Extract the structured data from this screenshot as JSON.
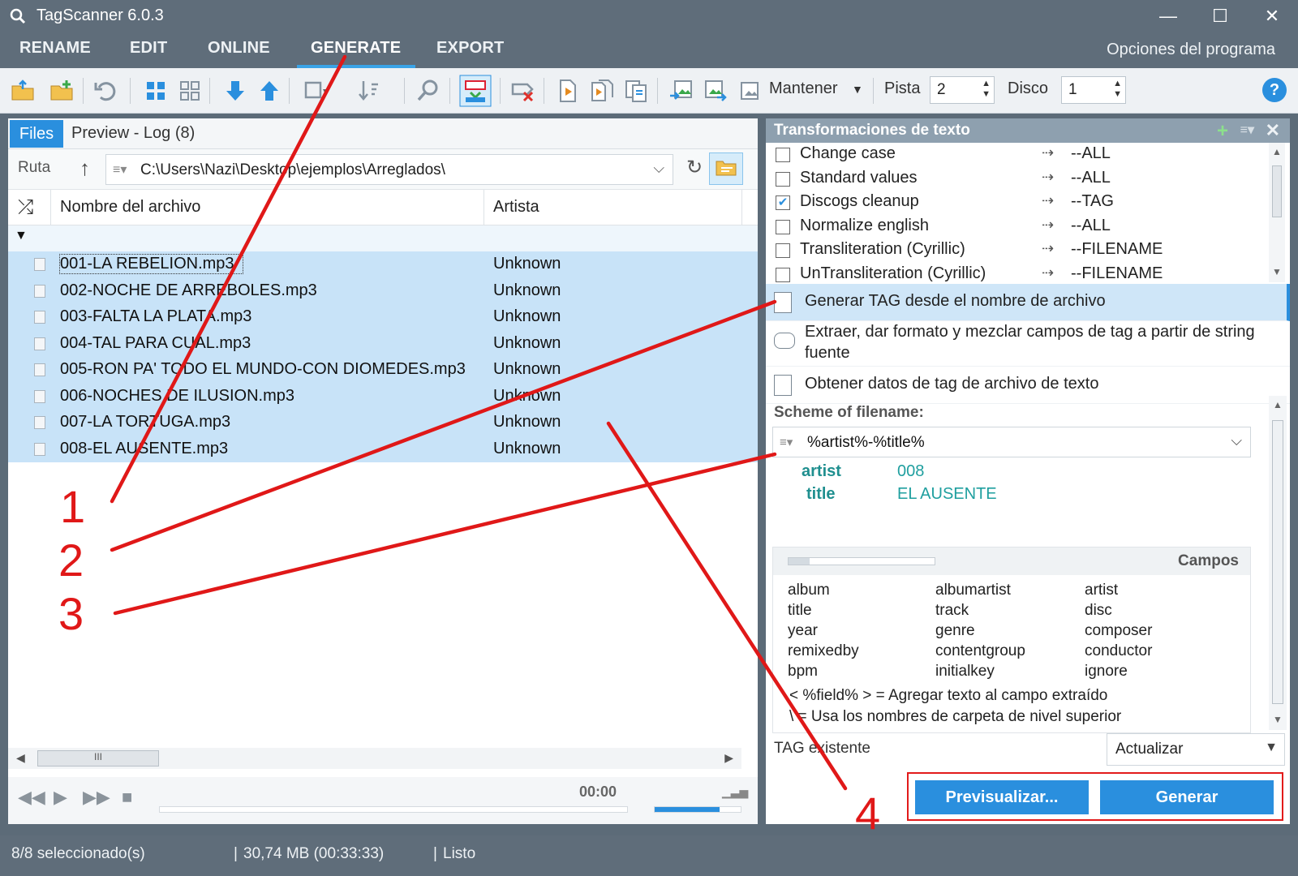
{
  "window": {
    "title": "TagScanner 6.0.3",
    "minimize": "—",
    "maximize": "☐",
    "close": "✕"
  },
  "menu": {
    "items": [
      "RENAME",
      "EDIT",
      "ONLINE",
      "GENERATE",
      "EXPORT"
    ],
    "active": "GENERATE",
    "program_options": "Opciones del programa"
  },
  "toolbar": {
    "keep_label": "Mantener",
    "track_label": "Pista",
    "track_value": "2",
    "disc_label": "Disco",
    "disc_value": "1",
    "help": "?"
  },
  "files_panel": {
    "tab_files": "Files",
    "tab_preview": "Preview - Log (8)",
    "path_label": "Ruta",
    "path_value": "C:\\Users\\Nazi\\Desktop\\ejemplos\\Arreglados\\",
    "columns": {
      "filename": "Nombre del archivo",
      "artist": "Artista"
    },
    "rows": [
      {
        "filename": "001-LA REBELION.mp3",
        "artist": "Unknown"
      },
      {
        "filename": "002-NOCHE DE ARREBOLES.mp3",
        "artist": "Unknown"
      },
      {
        "filename": "003-FALTA LA PLATA.mp3",
        "artist": "Unknown"
      },
      {
        "filename": "004-TAL PARA CUAL.mp3",
        "artist": "Unknown"
      },
      {
        "filename": "005-RON PA' TODO EL MUNDO-CON DIOMEDES.mp3",
        "artist": "Unknown"
      },
      {
        "filename": "006-NOCHES DE ILUSION.mp3",
        "artist": "Unknown"
      },
      {
        "filename": "007-LA TORTUGA.mp3",
        "artist": "Unknown"
      },
      {
        "filename": "008-EL AUSENTE.mp3",
        "artist": "Unknown"
      }
    ],
    "scroll_thumb": "III"
  },
  "player": {
    "time": "00:00",
    "volume_level": 0.75
  },
  "transformations": {
    "title": "Transformaciones de texto",
    "items": [
      {
        "label": "Change case",
        "target": "--ALL",
        "checked": false
      },
      {
        "label": "Standard values",
        "target": "--ALL",
        "checked": false
      },
      {
        "label": "Discogs cleanup",
        "target": "--TAG",
        "checked": true
      },
      {
        "label": "Normalize english",
        "target": "--ALL",
        "checked": false
      },
      {
        "label": "Transliteration (Cyrillic)",
        "target": "--FILENAME",
        "checked": false
      },
      {
        "label": "UnTransliteration (Cyrillic)",
        "target": "--FILENAME",
        "checked": false
      }
    ]
  },
  "actions": {
    "gen_from_filename": "Generar TAG desde el nombre de archivo",
    "extract_format": "Extraer, dar formato y mezclar campos de tag a partir de string fuente",
    "from_text_file": "Obtener datos de tag de archivo de texto"
  },
  "scheme": {
    "title": "Scheme of filename:",
    "value": "%artist%-%title%",
    "preview": {
      "artist_key": "artist",
      "artist_val": "008",
      "title_key": "title",
      "title_val": "EL AUSENTE"
    }
  },
  "campos": {
    "title": "Campos",
    "fields": [
      "album",
      "albumartist",
      "artist",
      "title",
      "track",
      "disc",
      "year",
      "genre",
      "composer",
      "remixedby",
      "contentgroup",
      "conductor",
      "bpm",
      "initialkey",
      "ignore"
    ],
    "hint1": "< %field% > = Agregar texto al campo extraído",
    "hint2": "\\ = Usa los nombres de carpeta de nivel superior"
  },
  "existing_tag": {
    "label": "TAG existente",
    "value": "Actualizar"
  },
  "buttons": {
    "preview": "Previsualizar...",
    "generate": "Generar"
  },
  "status": {
    "selected": "8/8 seleccionado(s)",
    "size": "30,74 MB (00:33:33)",
    "state": "Listo"
  },
  "annotations": {
    "n1": "1",
    "n2": "2",
    "n3": "3",
    "n4": "4",
    "color": "#e01818"
  }
}
